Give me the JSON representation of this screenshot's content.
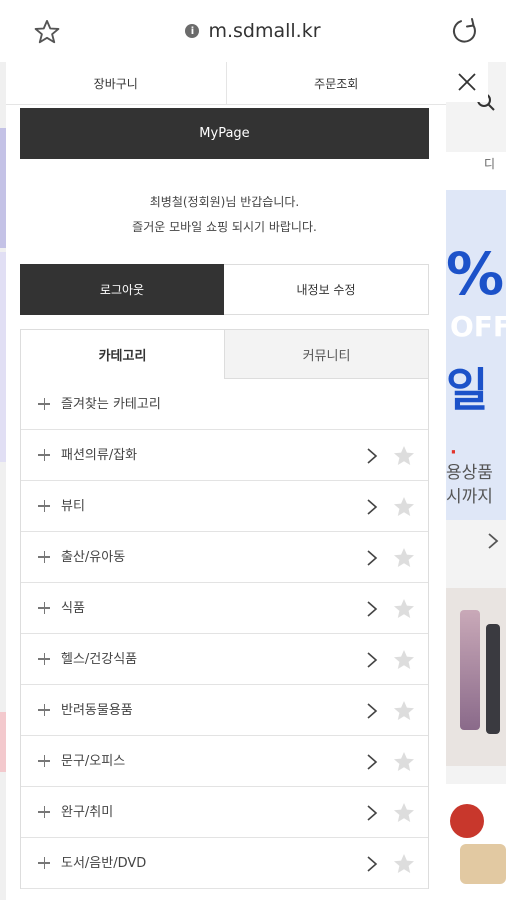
{
  "browser": {
    "url": "m.sdmall.kr",
    "icons": {
      "bookmark": "star-outline-icon",
      "info": "info-icon",
      "reload": "reload-icon"
    }
  },
  "drawer": {
    "top_buttons": {
      "cart": "장바구니",
      "order_lookup": "주문조회"
    },
    "close_icon": "close-icon",
    "mypage_label": "MyPage",
    "greeting_line1": "최병철(정회원)님 반갑습니다.",
    "greeting_line2": "즐거운 모바일 쇼핑 되시기 바랍니다.",
    "logout_label": "로그아웃",
    "edit_profile_label": "내정보 수정",
    "tabs": [
      {
        "label": "카테고리",
        "active": true
      },
      {
        "label": "커뮤니티",
        "active": false
      }
    ],
    "favorite_header": "즐겨찾는 카테고리",
    "categories": [
      "패션의류/잡화",
      "뷰티",
      "출산/유아동",
      "식품",
      "헬스/건강식품",
      "반려동물용품",
      "문구/오피스",
      "완구/취미",
      "도서/음반/DVD"
    ]
  },
  "background_page": {
    "nav_fragment": "디",
    "banner_percent": "%",
    "banner_off": "OFF",
    "banner_char": "일",
    "banner_line1": "용상품",
    "banner_line2": "시까지"
  },
  "colors": {
    "dark": "#333333",
    "banner_blue": "#1c52c9",
    "star_gray": "#dddddd"
  }
}
